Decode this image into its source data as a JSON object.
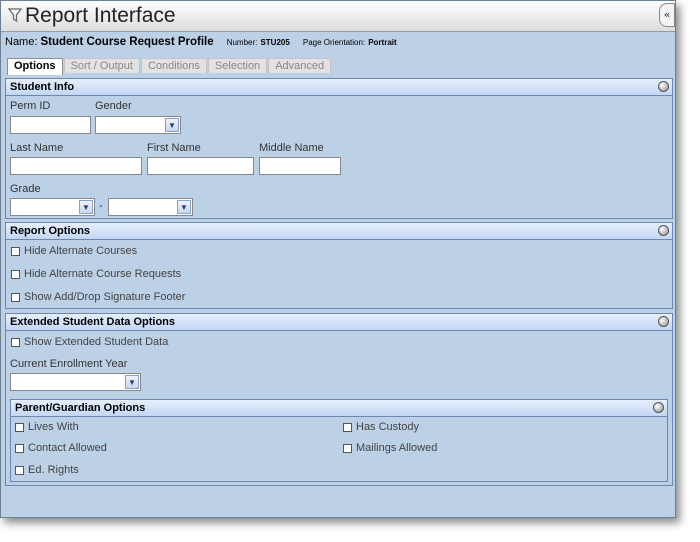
{
  "window": {
    "title": "Report Interface",
    "collapse_label": "«"
  },
  "info": {
    "name_label": "Name:",
    "name_value": "Student Course Request Profile",
    "number_label": "Number:",
    "number_value": "STU205",
    "orientation_label": "Page Orientation:",
    "orientation_value": "Portrait"
  },
  "tabs": [
    "Options",
    "Sort / Output",
    "Conditions",
    "Selection",
    "Advanced"
  ],
  "student_info": {
    "header": "Student Info",
    "perm_id_label": "Perm ID",
    "gender_label": "Gender",
    "last_name_label": "Last Name",
    "first_name_label": "First Name",
    "middle_name_label": "Middle Name",
    "grade_label": "Grade",
    "grade_separator": "-"
  },
  "report_options": {
    "header": "Report Options",
    "items": [
      "Hide Alternate Courses",
      "Hide Alternate Course Requests",
      "Show Add/Drop Signature Footer"
    ]
  },
  "extended": {
    "header": "Extended Student Data Options",
    "show_label": "Show Extended Student Data",
    "enrollment_label": "Current Enrollment Year"
  },
  "parent": {
    "header": "Parent/Guardian Options",
    "left_items": [
      "Lives With",
      "Contact Allowed",
      "Ed. Rights"
    ],
    "right_items": [
      "Has Custody",
      "Mailings Allowed"
    ]
  },
  "icons": {
    "title": "filter-icon",
    "section_toggle": "collapse-circle-icon",
    "dropdown": "chevron-down-icon"
  }
}
